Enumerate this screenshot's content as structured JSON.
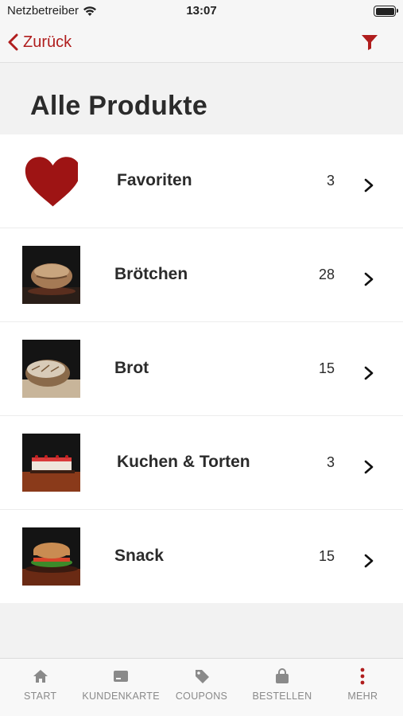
{
  "status_bar": {
    "carrier": "Netzbetreiber",
    "time": "13:07"
  },
  "nav": {
    "back_label": "Zurück"
  },
  "page": {
    "title": "Alle Produkte"
  },
  "categories": [
    {
      "label": "Favoriten",
      "count": "3",
      "icon": "heart-icon"
    },
    {
      "label": "Brötchen",
      "count": "28",
      "icon": "broetchen-image"
    },
    {
      "label": "Brot",
      "count": "15",
      "icon": "brot-image"
    },
    {
      "label": "Kuchen & Torten",
      "count": "3",
      "icon": "kuchen-image"
    },
    {
      "label": "Snack",
      "count": "15",
      "icon": "snack-image"
    }
  ],
  "tabs": [
    {
      "label": "START",
      "icon": "home-icon"
    },
    {
      "label": "KUNDENKARTE",
      "icon": "card-icon"
    },
    {
      "label": "COUPONS",
      "icon": "tag-icon"
    },
    {
      "label": "BESTELLEN",
      "icon": "bag-icon"
    },
    {
      "label": "MEHR",
      "icon": "more-icon"
    }
  ],
  "colors": {
    "accent": "#b01d1d",
    "tab_inactive": "#8a8a8a"
  }
}
